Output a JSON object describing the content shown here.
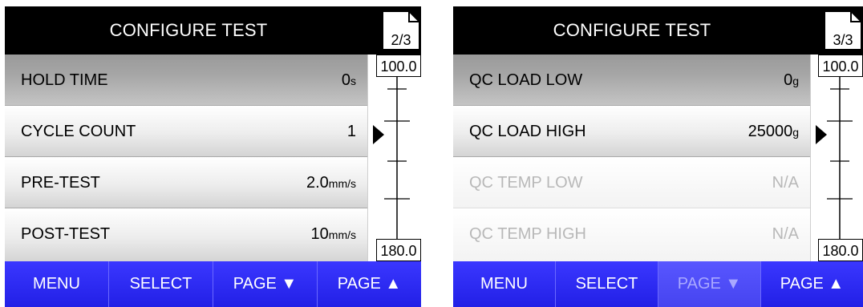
{
  "screens": [
    {
      "title": "CONFIGURE TEST",
      "page": "2/3",
      "scale_top": "100.0",
      "scale_bottom": "180.0",
      "rows": [
        {
          "label": "HOLD TIME",
          "value": "0",
          "unit": "s"
        },
        {
          "label": "CYCLE COUNT",
          "value": "1",
          "unit": ""
        },
        {
          "label": "PRE-TEST",
          "value": "2.0",
          "unit": "mm/s"
        },
        {
          "label": "POST-TEST",
          "value": "10",
          "unit": "mm/s"
        }
      ],
      "buttons": {
        "menu": "MENU",
        "select": "SELECT",
        "page_down": "PAGE ▼",
        "page_up": "PAGE ▲"
      }
    },
    {
      "title": "CONFIGURE TEST",
      "page": "3/3",
      "scale_top": "100.0",
      "scale_bottom": "180.0",
      "rows": [
        {
          "label": "QC LOAD LOW",
          "value": "0",
          "unit": "g"
        },
        {
          "label": "QC LOAD HIGH",
          "value": "25000",
          "unit": "g"
        },
        {
          "label": "QC TEMP LOW",
          "value": "N/A",
          "unit": ""
        },
        {
          "label": "QC TEMP HIGH",
          "value": "N/A",
          "unit": ""
        }
      ],
      "buttons": {
        "menu": "MENU",
        "select": "SELECT",
        "page_down": "PAGE ▼",
        "page_up": "PAGE ▲"
      }
    }
  ]
}
